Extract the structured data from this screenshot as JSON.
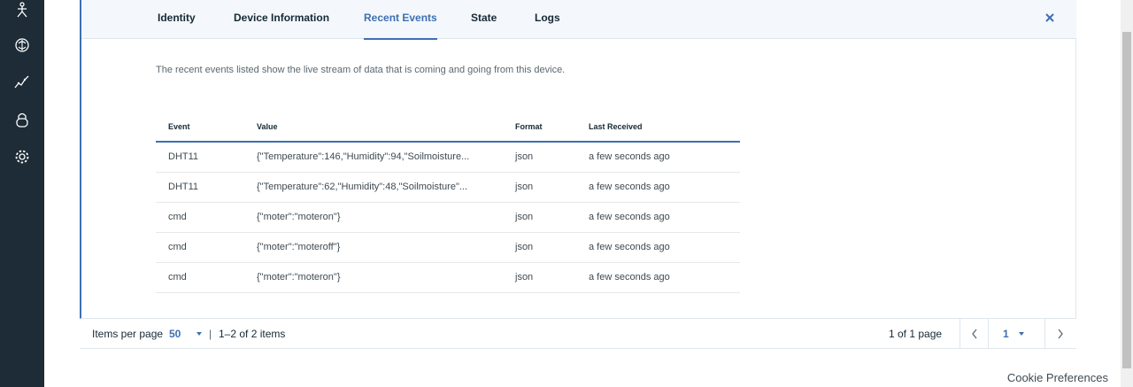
{
  "sidebar": {
    "icons": [
      "person-icon",
      "brain-icon",
      "analytics-icon",
      "security-lock-icon",
      "settings-gear-icon"
    ]
  },
  "tabs": [
    {
      "label": "Identity",
      "active": false
    },
    {
      "label": "Device Information",
      "active": false
    },
    {
      "label": "Recent Events",
      "active": true
    },
    {
      "label": "State",
      "active": false
    },
    {
      "label": "Logs",
      "active": false
    }
  ],
  "description": "The recent events listed show the live stream of data that is coming and going from this device.",
  "table": {
    "headers": [
      "Event",
      "Value",
      "Format",
      "Last Received"
    ],
    "rows": [
      {
        "event": "DHT11",
        "value": "{\"Temperature\":146,\"Humidity\":94,\"Soilmoisture...",
        "format": "json",
        "received": "a few seconds ago"
      },
      {
        "event": "DHT11",
        "value": "{\"Temperature\":62,\"Humidity\":48,\"Soilmoisture\"...",
        "format": "json",
        "received": "a few seconds ago"
      },
      {
        "event": "cmd",
        "value": "{\"moter\":\"moteron\"}",
        "format": "json",
        "received": "a few seconds ago"
      },
      {
        "event": "cmd",
        "value": "{\"moter\":\"moteroff\"}",
        "format": "json",
        "received": "a few seconds ago"
      },
      {
        "event": "cmd",
        "value": "{\"moter\":\"moteron\"}",
        "format": "json",
        "received": "a few seconds ago"
      }
    ]
  },
  "pagination": {
    "items_per_page_label": "Items per page",
    "items_per_page_value": "50",
    "range_text": "1–2 of 2 items",
    "page_text": "1 of 1 page",
    "current_page": "1"
  },
  "footer": {
    "cookie": "Cookie Preferences"
  },
  "colors": {
    "accent": "#3d70b2",
    "sidebar": "#1d2c37",
    "tabbar": "#f4f7fb"
  }
}
